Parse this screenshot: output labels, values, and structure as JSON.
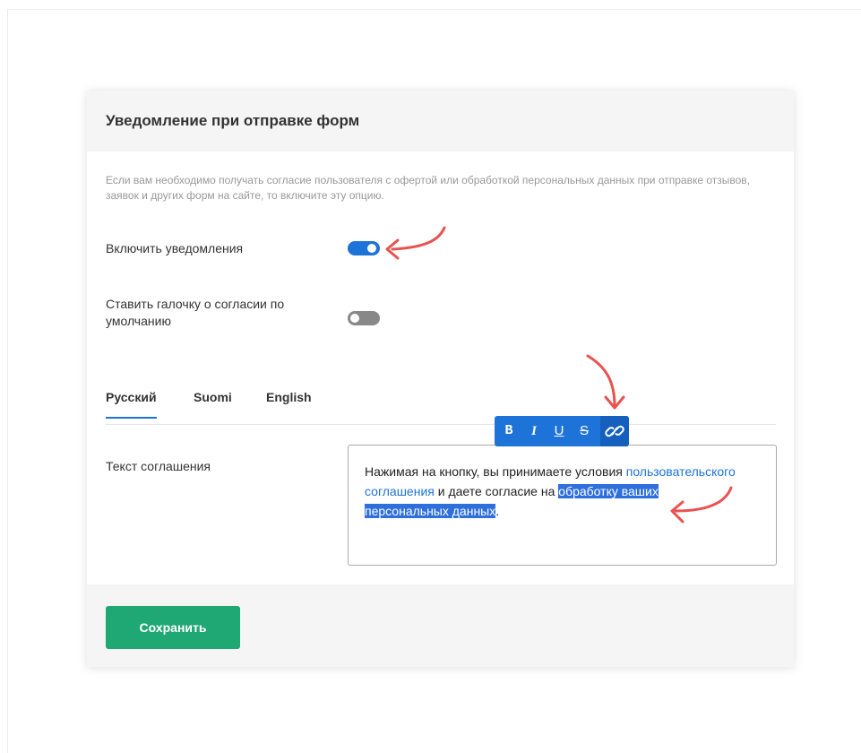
{
  "card": {
    "title": "Уведомление при отправке форм",
    "description": "Если вам необходимо получать согласие пользователя с офертой или обработкой персональных данных при отправке отзывов, заявок и других форм на сайте, то включите эту опцию."
  },
  "settings": [
    {
      "label": "Включить уведомления",
      "enabled": true
    },
    {
      "label": "Ставить галочку о согласии по умолчанию",
      "enabled": false
    }
  ],
  "tabs": [
    {
      "label": "Русский",
      "active": true
    },
    {
      "label": "Suomi",
      "active": false
    },
    {
      "label": "English",
      "active": false
    }
  ],
  "agreement": {
    "label": "Текст соглашения",
    "text_part1": "Нажимая на кнопку, вы принимаете условия ",
    "link1": "пользовательского соглашения",
    "text_part2": " и даете согласие на ",
    "link2_selected": "обработку ваших персональных данных",
    "text_part3": "."
  },
  "toolbar": {
    "bold": "B",
    "italic": "I",
    "underline": "U",
    "strike": "S",
    "link_icon": "link-icon"
  },
  "footer": {
    "save_label": "Сохранить"
  },
  "colors": {
    "accent": "#1e73d8",
    "save": "#1fa774",
    "annotation_arrow": "#e8524f"
  }
}
